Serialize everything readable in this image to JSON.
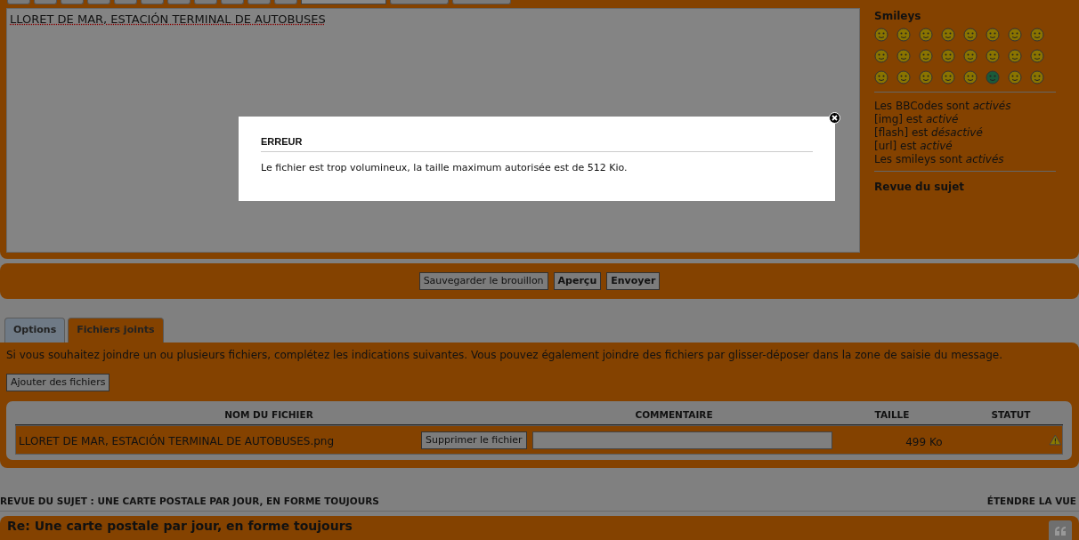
{
  "editor": {
    "value": "LLORET DE MAR, ESTACIÓN TERMINAL DE AUTOBUSES"
  },
  "sidebar": {
    "title": "Smileys",
    "status_lines": [
      "Les BBCodes sont *activés*",
      "[img] est *activé*",
      "[flash] est *désactivé*",
      "[url] est *activé*",
      "Les smileys sont *activés*"
    ],
    "review_link": "Revue du sujet"
  },
  "actions": [
    {
      "label": "Sauvegarder le brouillon",
      "kind": "default"
    },
    {
      "label": "Aperçu",
      "kind": "primary"
    },
    {
      "label": "Envoyer",
      "kind": "primary"
    }
  ],
  "tabs": [
    {
      "label": "Options",
      "selected": false
    },
    {
      "label": "Fichiers joints",
      "selected": true
    }
  ],
  "attachments": {
    "intro": "Si vous souhaitez joindre un ou plusieurs fichiers, complétez les indications suivantes. Vous pouvez également joindre des fichiers par glisser-déposer dans la zone de saisie du message.",
    "add_button": "Ajouter des fichiers",
    "columns": [
      "NOM DU FICHIER",
      "COMMENTAIRE",
      "TAILLE",
      "STATUT"
    ],
    "rows": [
      {
        "filename": "LLORET DE MAR, ESTACIÓN TERMINAL DE AUTOBUSES.png",
        "delete_button": "Supprimer le fichier",
        "size": "499 Ko",
        "kind": "warning"
      }
    ]
  },
  "review": {
    "title": "REVUE DU SUJET : UNE CARTE POSTALE PAR JOUR, EN FORME TOUJOURS",
    "expand": "ÉTENDRE LA VUE"
  },
  "post": {
    "title": "Re: Une carte postale par jour, en forme toujours"
  },
  "modal": {
    "title": "ERREUR",
    "message": "Le fichier est trop volumineux, la taille maximum autorisée est de 512 Kio."
  }
}
